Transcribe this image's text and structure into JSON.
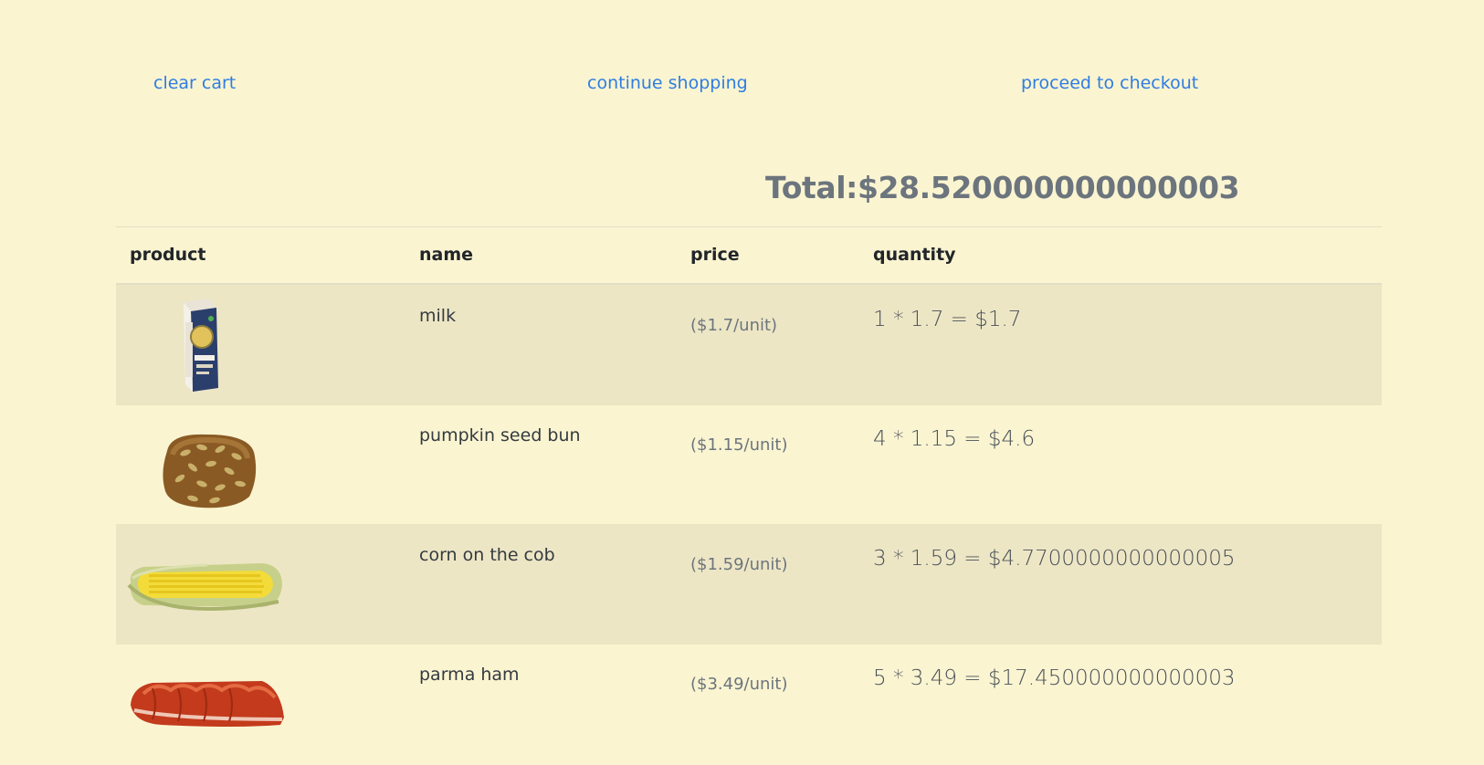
{
  "actions": {
    "clear": "clear cart",
    "continue": "continue shopping",
    "checkout": "proceed to checkout"
  },
  "total": "Total:$28.520000000000003",
  "table": {
    "headers": [
      "product",
      "name",
      "price",
      "quantity"
    ],
    "rows": [
      {
        "product_icon": "milk-carton-icon",
        "name": "milk",
        "price": "($1.7/unit)",
        "quantity": "1 * 1.7 = $1.7"
      },
      {
        "product_icon": "pumpkin-seed-bun-icon",
        "name": "pumpkin seed bun",
        "price": "($1.15/unit)",
        "quantity": "4 * 1.15 = $4.6"
      },
      {
        "product_icon": "corn-on-the-cob-icon",
        "name": "corn on the cob",
        "price": "($1.59/unit)",
        "quantity": "3 * 1.59 = $4.7700000000000005"
      },
      {
        "product_icon": "parma-ham-icon",
        "name": "parma ham",
        "price": "($3.49/unit)",
        "quantity": "5 * 3.49 = $17.450000000000003"
      }
    ]
  }
}
